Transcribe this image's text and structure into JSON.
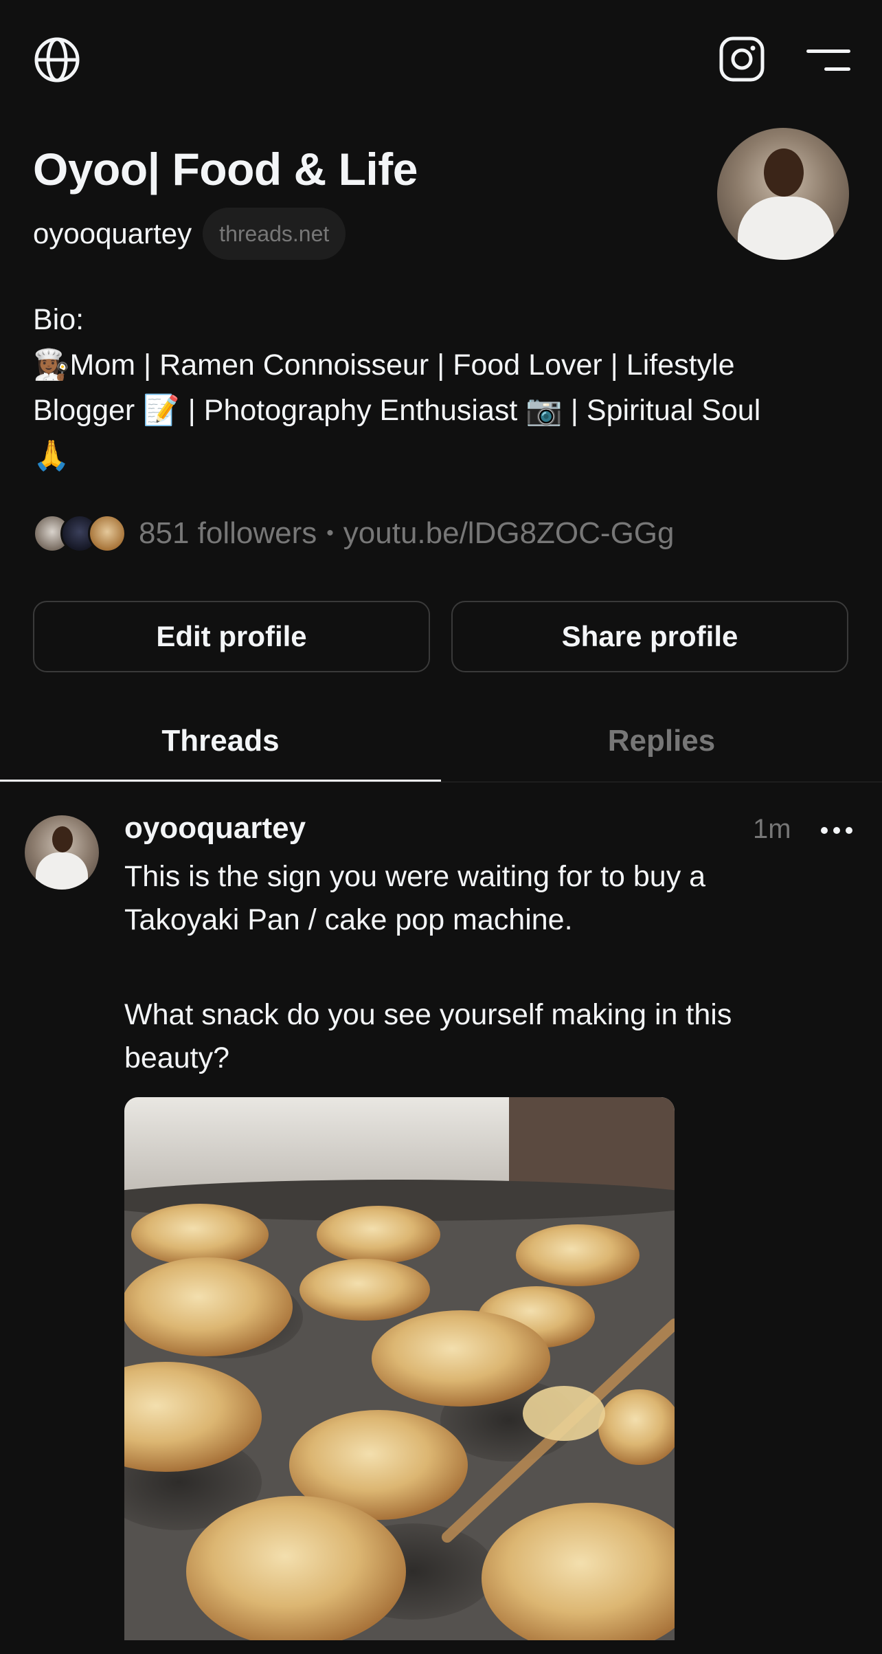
{
  "profile": {
    "display_name": "Oyoo| Food & Life",
    "handle": "oyooquartey",
    "domain_badge": "threads.net"
  },
  "bio": {
    "lines": [
      "Bio:",
      "👩🏾‍🍳Mom | Ramen Connoisseur | Food Lover | Lifestyle",
      "Blogger 📝 | Photography Enthusiast 📷 | Spiritual Soul",
      "🙏"
    ]
  },
  "stats": {
    "followers": "851 followers",
    "separator": "•",
    "link": "youtu.be/lDG8ZOC-GGg"
  },
  "actions": {
    "edit_label": "Edit profile",
    "share_label": "Share profile"
  },
  "tabs": [
    {
      "label": "Threads",
      "active": true
    },
    {
      "label": "Replies",
      "active": false
    }
  ],
  "post": {
    "username": "oyooquartey",
    "time": "1m",
    "text_lines": [
      "This is the sign you were waiting for to buy a",
      "Takoyaki Pan / cake pop machine.",
      "",
      "What snack do you see yourself making in this",
      "beauty?"
    ]
  },
  "icons": {
    "globe": "globe-icon",
    "instagram": "instagram-icon",
    "menu": "menu-icon",
    "more": "more-icon"
  },
  "colors": {
    "background": "#101010",
    "text": "#f3f5f7",
    "muted": "#777777",
    "border": "#3a3a3a"
  }
}
